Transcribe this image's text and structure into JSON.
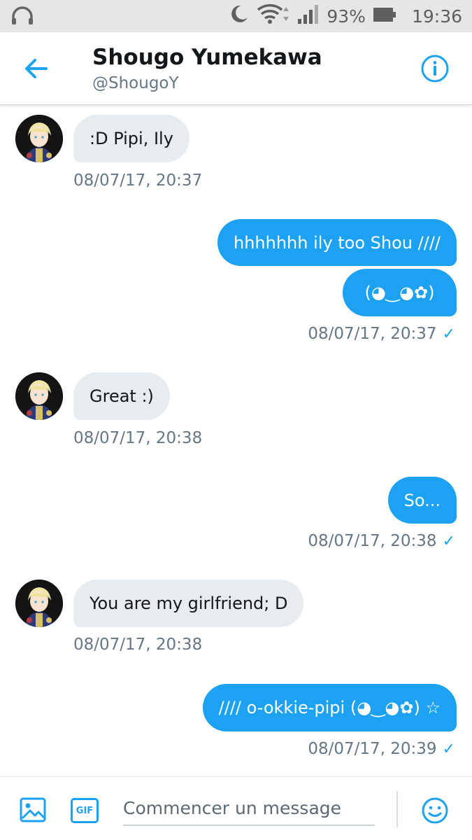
{
  "status_bar": {
    "left_icon": "headset-icon",
    "icons": [
      "moon-icon",
      "wifi-icon",
      "signal-icon",
      "battery-icon"
    ],
    "battery": "93%",
    "time": "19:36"
  },
  "header": {
    "name": "Shougo Yumekawa",
    "handle": "@ShougoY"
  },
  "messages": [
    {
      "direction": "incoming",
      "text": ":D Pipi, Ily",
      "timestamp": "08/07/17, 20:37"
    },
    {
      "direction": "outgoing",
      "text": "hhhhhhh ily too Shou ////"
    },
    {
      "direction": "outgoing",
      "text": "(◕‿◕✿)",
      "timestamp": "08/07/17, 20:37",
      "read": true
    },
    {
      "direction": "incoming",
      "text": "Great :)",
      "timestamp": "08/07/17, 20:38"
    },
    {
      "direction": "outgoing",
      "text": "So...",
      "timestamp": "08/07/17, 20:38",
      "read": true
    },
    {
      "direction": "incoming",
      "text": "You are my girlfriend; D",
      "timestamp": "08/07/17, 20:38"
    },
    {
      "direction": "outgoing",
      "text": "//// o-okkie-pipi (◕‿◕✿) ☆",
      "timestamp": "08/07/17, 20:39",
      "read": true
    }
  ],
  "composer": {
    "gif_label": "GIF",
    "placeholder": "Commencer un message"
  },
  "colors": {
    "accent": "#1da1f2",
    "incoming_bubble": "#e6ecf0",
    "secondary_text": "#657786"
  }
}
